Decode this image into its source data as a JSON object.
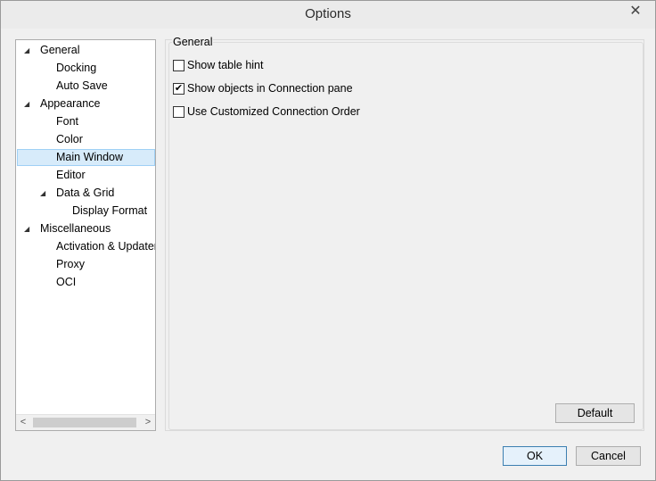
{
  "window": {
    "title": "Options",
    "close_symbol": "✕"
  },
  "tree": {
    "items": [
      {
        "label": "General",
        "expanded": true,
        "level": 0
      },
      {
        "label": "Docking",
        "level": 1
      },
      {
        "label": "Auto Save",
        "level": 1
      },
      {
        "label": "Appearance",
        "expanded": true,
        "level": 0
      },
      {
        "label": "Font",
        "level": 1
      },
      {
        "label": "Color",
        "level": 1
      },
      {
        "label": "Main Window",
        "level": 1,
        "selected": true
      },
      {
        "label": "Editor",
        "level": 1
      },
      {
        "label": "Data & Grid",
        "expanded": true,
        "level": 1
      },
      {
        "label": "Display Format",
        "level": 2
      },
      {
        "label": "Miscellaneous",
        "expanded": true,
        "level": 0
      },
      {
        "label": "Activation & Updater",
        "level": 1
      },
      {
        "label": "Proxy",
        "level": 1
      },
      {
        "label": "OCI",
        "level": 1
      }
    ],
    "expander_symbol": "◢"
  },
  "group": {
    "title": "General",
    "options": [
      {
        "label": "Show table hint",
        "checked": false
      },
      {
        "label": "Show objects in Connection pane",
        "checked": true
      },
      {
        "label": "Use Customized Connection Order",
        "checked": false
      }
    ]
  },
  "buttons": {
    "default_label": "Default",
    "ok_label": "OK",
    "cancel_label": "Cancel"
  },
  "scroll": {
    "left": "<",
    "right": ">"
  },
  "check_symbol": "✔"
}
